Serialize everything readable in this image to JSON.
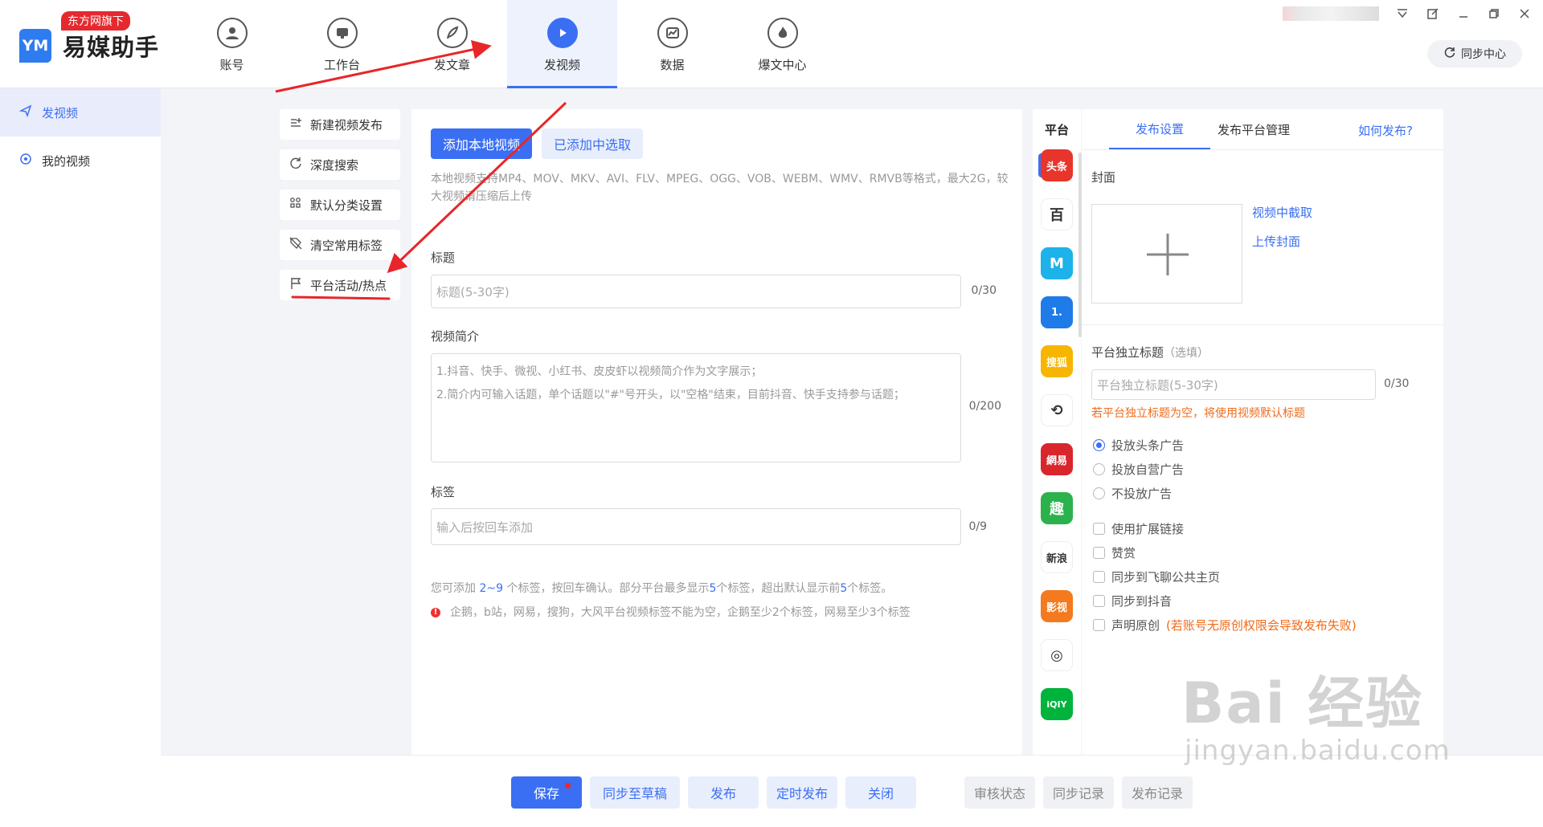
{
  "app": {
    "name": "易媒助手",
    "badge": "东方网旗下",
    "logo_mark": "YM"
  },
  "nav": [
    {
      "label": "账号",
      "icon": "user-icon"
    },
    {
      "label": "工作台",
      "icon": "monitor-icon"
    },
    {
      "label": "发文章",
      "icon": "feather-icon"
    },
    {
      "label": "发视频",
      "icon": "play-icon",
      "active": true
    },
    {
      "label": "数据",
      "icon": "chart-icon"
    },
    {
      "label": "爆文中心",
      "icon": "flame-icon"
    }
  ],
  "window": {
    "sync_center": "同步中心"
  },
  "sidebar": {
    "items": [
      {
        "label": "发视频",
        "icon": "send-icon",
        "active": true
      },
      {
        "label": "我的视频",
        "icon": "target-icon"
      }
    ]
  },
  "tools": [
    {
      "label": "新建视频发布",
      "icon": "list-add-icon"
    },
    {
      "label": "深度搜索",
      "icon": "refresh-search-icon"
    },
    {
      "label": "默认分类设置",
      "icon": "grid-icon"
    },
    {
      "label": "清空常用标签",
      "icon": "tag-clear-icon"
    },
    {
      "label": "平台活动/热点",
      "icon": "flag-icon"
    }
  ],
  "form": {
    "add_local": "添加本地视频",
    "select_added": "已添加中选取",
    "format_hint": "本地视频支持MP4、MOV、MKV、AVI、FLV、MPEG、OGG、VOB、WEBM、WMV、RMVB等格式，最大2G，较大视频请压缩后上传",
    "title_label": "标题",
    "title_placeholder": "标题(5-30字)",
    "title_counter": "0/30",
    "intro_label": "视频简介",
    "intro_hint_1": "1.抖音、快手、微视、小红书、皮皮虾以视频简介作为文字展示；",
    "intro_hint_2": "2.简介内可输入话题，单个话题以\"#\"号开头，以\"空格\"结束，目前抖音、快手支持参与话题；",
    "intro_counter": "0/200",
    "tags_label": "标签",
    "tags_placeholder": "输入后按回车添加",
    "tags_counter": "0/9",
    "tags_hint_a": "您可添加 ",
    "tags_hint_range": "2~9",
    "tags_hint_b": " 个标签，按回车确认。部分平台最多显示",
    "tags_hint_five1": "5",
    "tags_hint_c": "个标签，超出默认显示前",
    "tags_hint_five2": "5",
    "tags_hint_d": "个标签。",
    "tags_warning": "企鹅，b站，网易，搜狗，大风平台视频标签不能为空，企鹅至少2个标签，网易至少3个标签",
    "warn_mark": "!"
  },
  "platforms": {
    "header": "平台",
    "list": [
      {
        "name": "toutiao",
        "glyph": "头条",
        "color": "#e7352b"
      },
      {
        "name": "baijia",
        "glyph": "百",
        "color": "#ffffff"
      },
      {
        "name": "dayu",
        "glyph": "M",
        "color": "#1db2ea"
      },
      {
        "name": "yidian",
        "glyph": "1.",
        "color": "#1e7be8"
      },
      {
        "name": "sohu",
        "glyph": "搜狐",
        "color": "#f7b500"
      },
      {
        "name": "qie",
        "glyph": "⟲",
        "color": "#ffffff"
      },
      {
        "name": "wangyi",
        "glyph": "網易",
        "color": "#d9262c"
      },
      {
        "name": "qutoutiao",
        "glyph": "趣",
        "color": "#2bb24c"
      },
      {
        "name": "xinlang",
        "glyph": "新浪",
        "color": "#ffffff"
      },
      {
        "name": "bilibili-like",
        "glyph": "影视",
        "color": "#f47a1f"
      },
      {
        "name": "fenghuang",
        "glyph": "◎",
        "color": "#ffffff"
      },
      {
        "name": "iqiyi",
        "glyph": "iQIY",
        "color": "#00b33c"
      }
    ]
  },
  "settings": {
    "tabs": [
      "发布设置",
      "发布平台管理"
    ],
    "help_link": "如何发布?",
    "cover_label": "封面",
    "cover_plus": "+",
    "cover_from_video": "视频中截取",
    "cover_upload": "上传封面",
    "platform_title_label": "平台独立标题",
    "platform_title_optional": "（选填）",
    "platform_title_placeholder": "平台独立标题(5-30字)",
    "platform_title_counter": "0/30",
    "platform_title_note": "若平台独立标题为空，将使用视频默认标题",
    "ad_options": [
      "投放头条广告",
      "投放自营广告",
      "不投放广告"
    ],
    "checkboxes": [
      "使用扩展链接",
      "赞赏",
      "同步到飞聊公共主页",
      "同步到抖音"
    ],
    "original_label": "声明原创",
    "original_note": "(若账号无原创权限会导致发布失败)"
  },
  "bottom": {
    "save": "保存",
    "sync_draft": "同步至草稿",
    "publish": "发布",
    "schedule": "定时发布",
    "close": "关闭",
    "review_status": "审核状态",
    "sync_record": "同步记录",
    "publish_record": "发布记录"
  },
  "watermark": {
    "big": "Bai 经验",
    "small": "jingyan.baidu.com"
  },
  "colors": {
    "accent": "#3b6ff3",
    "annotation": "#e8262a",
    "warning": "#f06a1b"
  }
}
